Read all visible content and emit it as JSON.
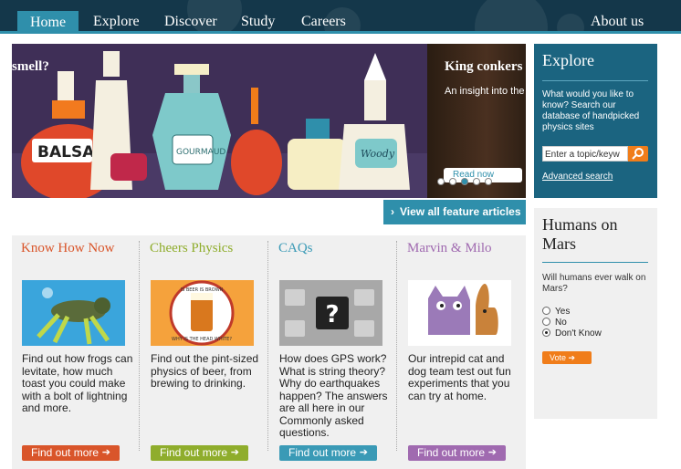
{
  "nav": {
    "items": [
      "Home",
      "Explore",
      "Discover",
      "Study",
      "Careers"
    ],
    "right": "About us",
    "active": "Home"
  },
  "hero": {
    "caption1": "smell?",
    "caption2": "King conkers",
    "sub2": "An insight into the",
    "read_now": "Read now",
    "bottle_labels": [
      "BALSA",
      "GOURMAUD",
      "Woody"
    ]
  },
  "view_all": "View all feature articles",
  "features": [
    {
      "title": "Know How Now",
      "color": "#d9552a",
      "desc": "Find out how frogs can levitate, how much toast you could make with a bolt of lightning and more.",
      "btn": "Find out more",
      "icon": "frog-image"
    },
    {
      "title": "Cheers Physics",
      "color": "#8fad2c",
      "desc": "Find out the pint-sized physics of beer, from brewing to drinking.",
      "btn": "Find out more",
      "icon": "beer-image",
      "badge_text": [
        "IS BEER IS BROWN",
        "WHY IS THE HEAD WHITE?"
      ]
    },
    {
      "title": "CAQs",
      "color": "#3a9ab6",
      "desc": "How does GPS work? What is string theory? Why do earthquakes happen? The answers are all here in our Commonly asked questions.",
      "btn": "Find out more",
      "icon": "keyboard-question-image"
    },
    {
      "title": "Marvin & Milo",
      "color": "#a06ab0",
      "desc": "Our intrepid cat and dog team test out fun experiments that you can try at home.",
      "btn": "Find out more",
      "icon": "cat-dog-image"
    }
  ],
  "explore": {
    "title": "Explore",
    "text": "What would you like to know? Search our database of handpicked physics sites",
    "placeholder": "Enter a topic/keyw",
    "advanced": "Advanced search"
  },
  "poll": {
    "title": "Humans on Mars",
    "question": "Will humans ever walk on Mars?",
    "options": [
      "Yes",
      "No",
      "Don't Know"
    ],
    "selected": "Don't Know",
    "vote": "Vote"
  },
  "colors": {
    "nav_bg": "#14374a",
    "accent": "#2f8fab",
    "orange": "#f07d1a"
  }
}
